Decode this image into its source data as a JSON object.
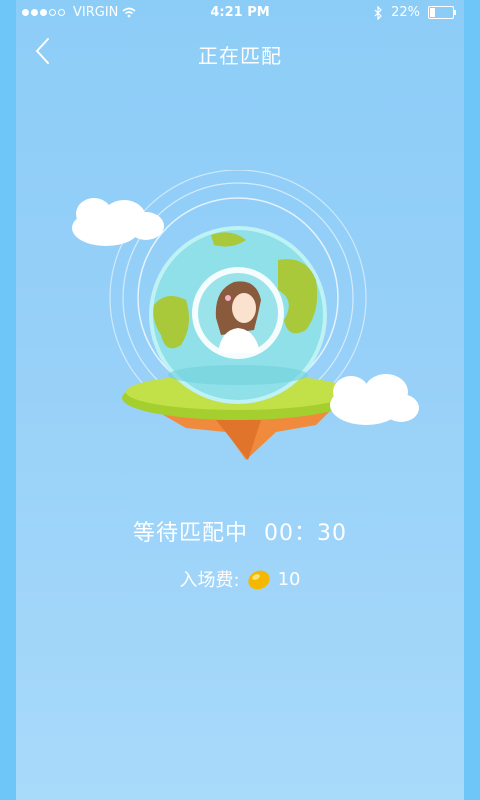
{
  "status_bar": {
    "carrier": "VIRGIN",
    "time": "4:21 PM",
    "battery": "22%",
    "battery_level": 0.22,
    "signal_bars": 3,
    "signal_total": 5
  },
  "nav": {
    "title": "正在匹配"
  },
  "match": {
    "waiting_label": "等待匹配中",
    "timer": "00：30",
    "fee_label": "入场费:",
    "fee_value": "10"
  },
  "colors": {
    "sky": "#8ccdf7",
    "grass": "#a5cf2f",
    "soil": "#f08a3c",
    "globe": "#8fe0e8"
  }
}
